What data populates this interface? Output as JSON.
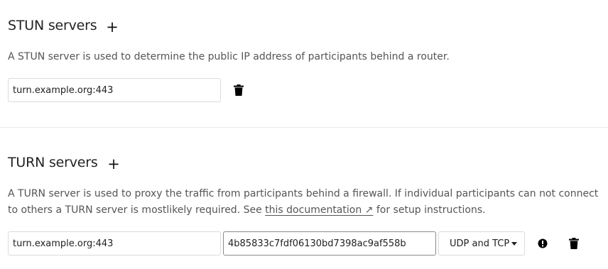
{
  "stun": {
    "title": "STUN servers",
    "add_label": "+",
    "description": "A STUN server is used to determine the public IP address of participants behind a router.",
    "servers": [
      {
        "value": "turn.example.org:443",
        "delete_icon": "trash-icon"
      }
    ]
  },
  "turn": {
    "title": "TURN servers",
    "add_label": "+",
    "description_prefix": "A TURN server is used to proxy the traffic from participants behind a firewall. If individual participants can not connect to others a TURN server is mostlikely required. See ",
    "doc_link": "this documentation ↗",
    "description_suffix": " for setup instructions.",
    "servers": [
      {
        "server": "turn.example.org:443",
        "secret": "4b85833c7fdf06130bd7398ac9af558b",
        "protocol": "UDP and TCP",
        "status_icon": "alert-circle-icon",
        "delete_icon": "trash-icon"
      }
    ]
  }
}
